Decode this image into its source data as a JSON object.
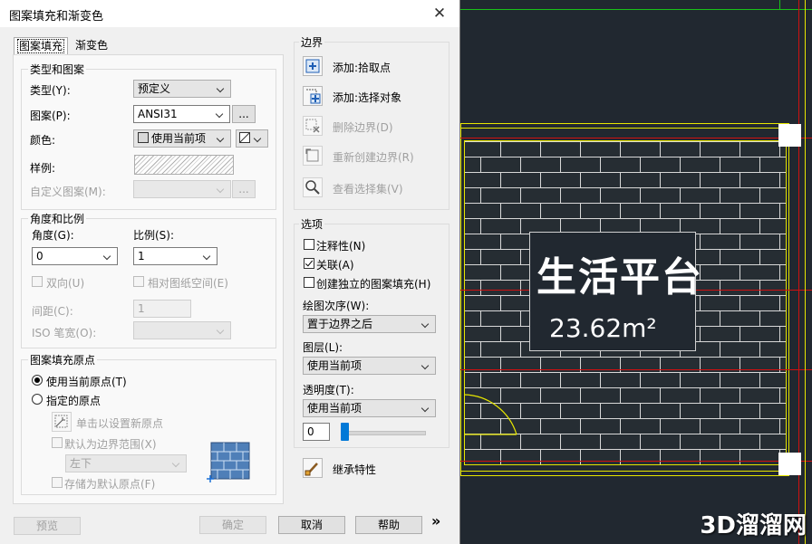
{
  "dialog": {
    "title": "图案填充和渐变色",
    "tabs": [
      {
        "label": "图案填充"
      },
      {
        "label": "渐变色"
      }
    ],
    "type_pattern": {
      "legend": "类型和图案",
      "type_label": "类型(Y):",
      "type_value": "预定义",
      "pattern_label": "图案(P):",
      "pattern_value": "ANSI31",
      "color_label": "颜色:",
      "color_value": "使用当前项",
      "sample_label": "样例:",
      "custom_label": "自定义图案(M):",
      "dots": "..."
    },
    "angle_scale": {
      "legend": "角度和比例",
      "angle_label": "角度(G):",
      "angle_value": "0",
      "scale_label": "比例(S):",
      "scale_value": "1",
      "double_label": "双向(U)",
      "relative_label": "相对图纸空间(E)",
      "spacing_label": "间距(C):",
      "spacing_value": "1",
      "iso_label": "ISO 笔宽(O):"
    },
    "origin": {
      "legend": "图案填充原点",
      "use_current": "使用当前原点(T)",
      "specified": "指定的原点",
      "click_set": "单击以设置新原点",
      "default_extents": "默认为边界范围(X)",
      "position_value": "左下",
      "store_default": "存储为默认原点(F)"
    },
    "boundary": {
      "legend": "边界",
      "add_pick": "添加:拾取点",
      "add_select": "添加:选择对象",
      "remove": "删除边界(D)",
      "recreate": "重新创建边界(R)",
      "view_selection": "查看选择集(V)"
    },
    "options": {
      "legend": "选项",
      "annotative": "注释性(N)",
      "associative": "关联(A)",
      "separate": "创建独立的图案填充(H)",
      "draw_order_label": "绘图次序(W):",
      "draw_order_value": "置于边界之后",
      "layer_label": "图层(L):",
      "layer_value": "使用当前项",
      "transparency_label": "透明度(T):",
      "transparency_value": "使用当前项",
      "transparency_number": "0",
      "transparency_fraction": 0
    },
    "inherit": "继承特性",
    "footer": {
      "preview": "预览",
      "ok": "确定",
      "cancel": "取消",
      "help": "帮助",
      "more": "»"
    }
  },
  "canvas": {
    "area_name": "生活平台",
    "area_value": "23.62m²",
    "watermark": "3D溜溜网"
  },
  "colors": {
    "canvas_bg": "#212830",
    "wall_yellow": "#e6e600",
    "axis_red": "#d01010",
    "axis_green": "#19c119",
    "accent_blue": "#0078d7"
  }
}
